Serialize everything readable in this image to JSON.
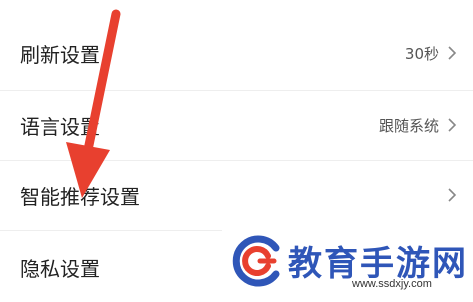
{
  "settings": {
    "items": [
      {
        "label": "刷新设置",
        "value": "30秒"
      },
      {
        "label": "语言设置",
        "value": "跟随系统"
      },
      {
        "label": "智能推荐设置",
        "value": ""
      },
      {
        "label": "隐私设置",
        "value": ""
      }
    ]
  },
  "icons": {
    "chevron": "chevron-right-icon",
    "annotation": "red-arrow-annotation"
  },
  "colors": {
    "arrow": "#e8402f",
    "watermark_blue": "#2f56b8",
    "watermark_red": "#e8402f"
  },
  "watermark": {
    "brand": "教育手游网",
    "url": "www.ssdxjy.com"
  }
}
